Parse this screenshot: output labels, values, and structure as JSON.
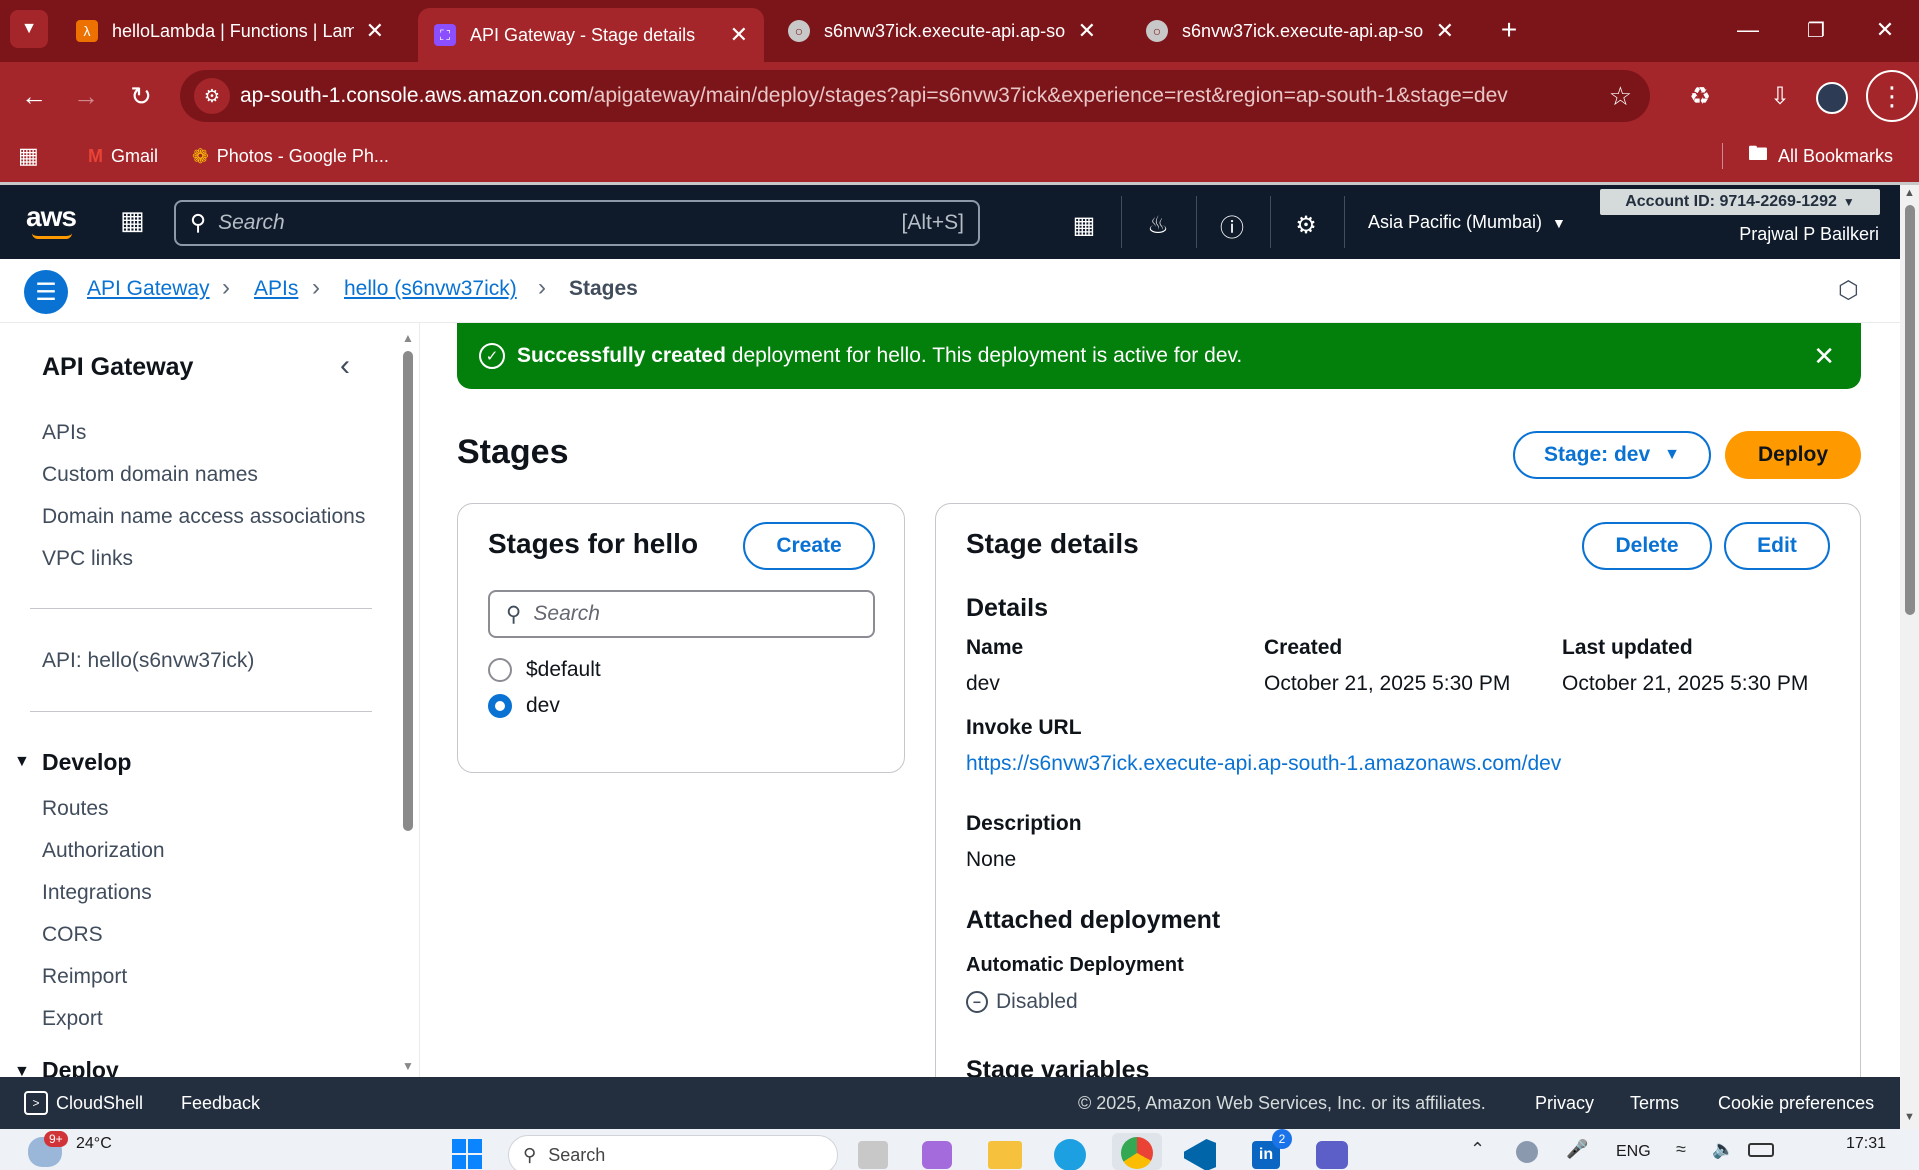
{
  "browser": {
    "tabs": [
      {
        "title": "helloLambda | Functions | Lamb",
        "icon": "aws-lambda-icon"
      },
      {
        "title": "API Gateway - Stage details",
        "icon": "api-gateway-icon"
      },
      {
        "title": "s6nvw37ick.execute-api.ap-sout",
        "icon": "globe-icon"
      },
      {
        "title": "s6nvw37ick.execute-api.ap-sout",
        "icon": "globe-icon"
      }
    ],
    "url_host": "ap-south-1.console.aws.amazon.com",
    "url_path": "/apigateway/main/deploy/stages?api=s6nvw37ick&experience=rest&region=ap-south-1&stage=dev",
    "bookmarks": [
      {
        "label": "Gmail"
      },
      {
        "label": "Photos - Google Ph..."
      }
    ],
    "all_bookmarks": "All Bookmarks"
  },
  "aws_nav": {
    "logo": "aws",
    "search_placeholder": "Search",
    "search_shortcut": "[Alt+S]",
    "region": "Asia Pacific (Mumbai)",
    "account_id": "Account ID: 9714-2269-1292",
    "user_name": "Prajwal P Bailkeri"
  },
  "breadcrumb": {
    "items": [
      "API Gateway",
      "APIs",
      "hello (s6nvw37ick)"
    ],
    "current": "Stages"
  },
  "sidebar": {
    "title": "API Gateway",
    "items": [
      "APIs",
      "Custom domain names",
      "Domain name access associations",
      "VPC links"
    ],
    "api_label": "API: hello(s6nvw37ick)",
    "develop_title": "Develop",
    "develop_items": [
      "Routes",
      "Authorization",
      "Integrations",
      "CORS",
      "Reimport",
      "Export"
    ],
    "deploy_title": "Deploy"
  },
  "flash": {
    "bold": "Successfully created",
    "text": " deployment for hello. This deployment is active for dev."
  },
  "page": {
    "title": "Stages",
    "stage_dropdown": "Stage: dev",
    "deploy_button": "Deploy"
  },
  "stages_panel": {
    "title": "Stages for hello",
    "create_button": "Create",
    "search_placeholder": "Search",
    "stages": [
      {
        "name": "$default",
        "selected": false
      },
      {
        "name": "dev",
        "selected": true
      }
    ]
  },
  "details_panel": {
    "title": "Stage details",
    "delete_button": "Delete",
    "edit_button": "Edit",
    "section_details": "Details",
    "name_label": "Name",
    "name_value": "dev",
    "created_label": "Created",
    "created_value": "October 21, 2025 5:30 PM",
    "updated_label": "Last updated",
    "updated_value": "October 21, 2025 5:30 PM",
    "invoke_label": "Invoke URL",
    "invoke_value": "https://s6nvw37ick.execute-api.ap-south-1.amazonaws.com/dev",
    "description_label": "Description",
    "description_value": "None",
    "attached_title": "Attached deployment",
    "auto_label": "Automatic Deployment",
    "auto_value": "Disabled",
    "stage_vars_title": "Stage variables"
  },
  "footer": {
    "cloudshell": "CloudShell",
    "feedback": "Feedback",
    "copyright": "© 2025, Amazon Web Services, Inc. or its affiliates.",
    "privacy": "Privacy",
    "terms": "Terms",
    "cookies": "Cookie preferences"
  },
  "taskbar": {
    "weather_badge": "9+",
    "temperature": "24°C",
    "search_placeholder": "Search",
    "linkedin_badge": "2",
    "language": "ENG",
    "time": "17:31"
  },
  "colors": {
    "chrome_dark": "#7c1519",
    "chrome": "#a4262a",
    "aws_nav": "#0f1b2a",
    "link": "#0972d3",
    "success": "#037f0c",
    "deploy": "#ff9900"
  }
}
